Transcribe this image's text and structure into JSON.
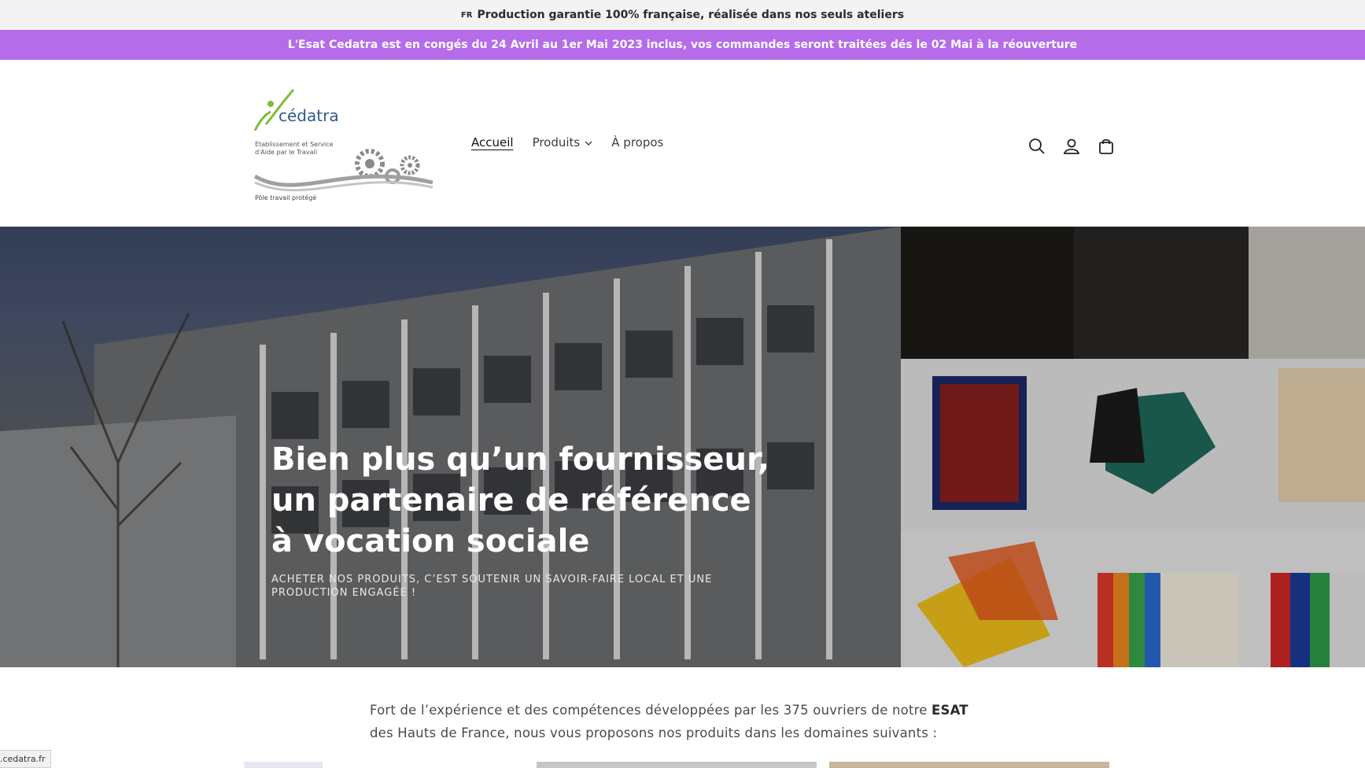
{
  "topbar": {
    "flag": "FR",
    "text": "Production garantie 100% française, réalisée dans nos seuls ateliers"
  },
  "promo": {
    "text": "L'Esat Cedatra est en congés du 24 Avril au 1er Mai 2023 inclus, vos commandes seront traitées dés le 02 Mai à la réouverture"
  },
  "logo": {
    "brand": "cédatra",
    "line1": "Établissement et Service",
    "line2": "d'Aide par le Travail",
    "tagline": "Pôle travail protégé",
    "accent": "#7cbf3a"
  },
  "nav": {
    "home": "Accueil",
    "products": "Produits",
    "about": "À propos"
  },
  "header_icons": [
    "search-icon",
    "account-icon",
    "cart-icon"
  ],
  "hero": {
    "title": "Bien plus qu’un fournisseur, un partenaire de référence à vocation sociale",
    "subtitle": "ACHETER NOS PRODUITS, C’EST SOUTENIR UN SAVOIR-FAIRE LOCAL ET UNE PRODUCTION ENGAGÉE !"
  },
  "intro": {
    "before": "Fort de l’expérience et des compétences développées par les 375 ouvriers de notre ",
    "strong": "ESAT",
    "after": " des Hauts de France, nous vous proposons nos produits dans les domaines suivants :"
  },
  "status_url": ".cedatra.fr",
  "colors": {
    "promo_bg": "#b56ce9",
    "topbar_bg": "#f3f3f3"
  }
}
